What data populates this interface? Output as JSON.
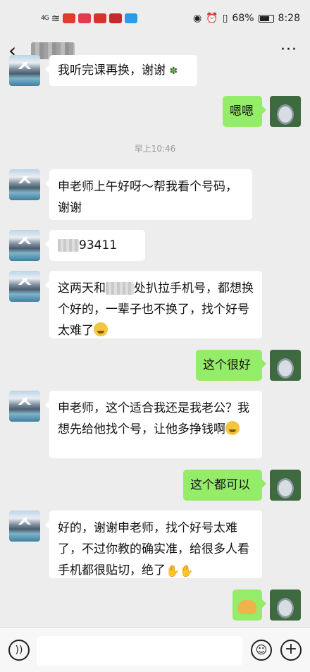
{
  "status_bar": {
    "signal": "4G",
    "battery": "68%",
    "battery_level": 0.68,
    "time": "8:28"
  },
  "header": {
    "back_icon": "chevron-left-icon",
    "more_icon": "more-dots-icon"
  },
  "messages": {
    "m1_text": "我听完课再换，谢谢",
    "m2_text": "嗯嗯",
    "timestamp": "早上10:46",
    "m3_text": "申老师上午好呀～帮我看个号码，谢谢",
    "m4_text": "93411",
    "m5_part1": "这两天和",
    "m5_part2": "处扒拉手机号，都想换个好的，一辈子也不换了，找个好号太难了",
    "m6_text": "这个很好",
    "m7_text": "申老师，这个适合我还是我老公？我想先给他找个号，让他多挣钱啊",
    "m8_text": "这个都可以",
    "m9_text": "好的，谢谢申老师，找个好号太难了，不过你教的确实准，给很多人看手机都很贴切，绝了"
  },
  "input_bar": {
    "voice_icon": "voice-icon",
    "emoji_icon": "smile-icon",
    "plus_icon": "plus-icon"
  }
}
